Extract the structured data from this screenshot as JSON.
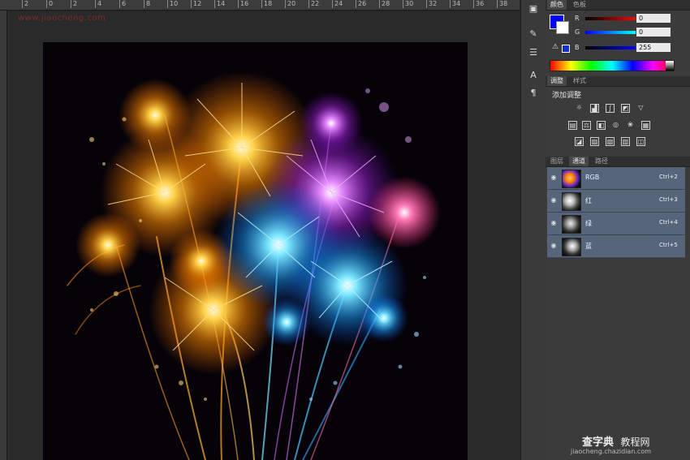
{
  "ruler": {
    "labels": [
      "2",
      "0",
      "2",
      "4",
      "6",
      "8",
      "10",
      "12",
      "14",
      "16",
      "18",
      "20",
      "22",
      "24",
      "26",
      "28",
      "30",
      "32",
      "34",
      "36",
      "38"
    ]
  },
  "watermark_top": "www.jiaocheng.com",
  "color_panel": {
    "tabs": [
      "颜色",
      "色板"
    ],
    "channels": [
      {
        "label": "R",
        "value": "0",
        "from": "#000000",
        "to": "#ff0000"
      },
      {
        "label": "G",
        "value": "0",
        "from": "#0000ff",
        "to": "#00ffff"
      },
      {
        "label": "B",
        "value": "255",
        "from": "#000000",
        "to": "#0000ff"
      }
    ]
  },
  "adjustments_panel": {
    "tabs": [
      "调整",
      "样式"
    ],
    "title": "添加调整"
  },
  "channels_panel": {
    "tabs": [
      "图层",
      "通道",
      "路径"
    ],
    "rows": [
      {
        "name": "RGB",
        "shortcut": "Ctrl+2"
      },
      {
        "name": "红",
        "shortcut": "Ctrl+3"
      },
      {
        "name": "绿",
        "shortcut": "Ctrl+4"
      },
      {
        "name": "蓝",
        "shortcut": "Ctrl+5"
      }
    ]
  },
  "watermark_bottom": {
    "main": "查字典",
    "suffix": "教程网",
    "url": "jiaocheng.chazidian.com"
  },
  "colors": {
    "accent": "#56657a",
    "background": "#282828"
  }
}
